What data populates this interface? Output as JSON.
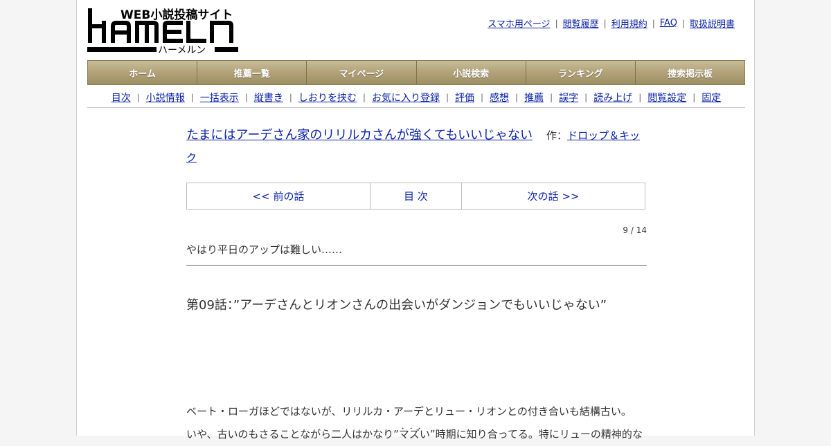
{
  "logo": {
    "main": "HAMELN",
    "tagline": "WEB小説投稿サイト",
    "kana": "ハーメルン"
  },
  "top_links": [
    "スマホ用ページ",
    "閲覧履歴",
    "利用規約",
    "FAQ",
    "取扱説明書"
  ],
  "main_nav": [
    "ホーム",
    "推薦一覧",
    "マイページ",
    "小説検索",
    "ランキング",
    "捜索掲示板"
  ],
  "sub_nav": [
    "目次",
    "小説情報",
    "一括表示",
    "縦書き",
    "しおりを挟む",
    "お気に入り登録",
    "評価",
    "感想",
    "推薦",
    "誤字",
    "読み上げ",
    "閲覧設定",
    "固定"
  ],
  "novel": {
    "title": "たまにはアーデさん家のリリルカさんが強くてもいいじゃない",
    "author_label": "作：",
    "author": "ドロップ＆キック"
  },
  "chapter_nav": {
    "prev": "<< 前の話",
    "toc": "目 次",
    "next": "次の話 >>"
  },
  "page_count": "9 / 14",
  "preface": "やはり平日のアップは難しい……",
  "chapter_title": "第09話：”アーデさんとリオンさんの出会いがダンジョンでもいいじゃない”",
  "body": {
    "line1": "ベート・ローガほどではないが、リリルカ・アーデとリュー・リオンとの付き合いも結構古い。",
    "line2_before": "いや、古いのもさることながら二人はかなり",
    "line2_emph": "”マズい”",
    "line2_after": "時期に知り合ってる。特にリューの精神的な"
  },
  "colors": {
    "link": "#0b22a8",
    "nav_gold": "#b3a47c"
  }
}
